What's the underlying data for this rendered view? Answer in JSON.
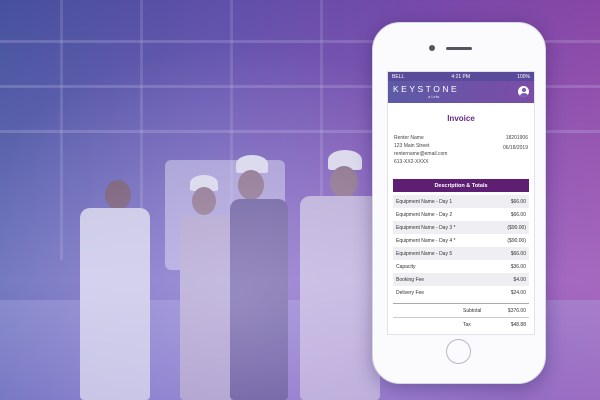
{
  "phone": {
    "status": {
      "carrier": "BELL",
      "time": "4:21 PM",
      "battery": "100%"
    },
    "brand": {
      "name": "KEYSTONE",
      "sub": "a Leta"
    },
    "invoice": {
      "title": "Invoice",
      "renter_name": "Renter Name",
      "address": "123 Main Street",
      "email": "rentername@email.com",
      "phone": "613-XX2-XXXX",
      "invoice_number": "18201906",
      "date": "06/18/2019",
      "section_title": "Description & Totals",
      "line_items": [
        {
          "label": "Equipment Name - Day 1",
          "amount": "$66.00"
        },
        {
          "label": "Equipment Name - Day 2",
          "amount": "$66.00"
        },
        {
          "label": "Equipment Name - Day 3 *",
          "amount": "($90.00)"
        },
        {
          "label": "Equipment Name - Day 4 *",
          "amount": "($90.00)"
        },
        {
          "label": "Equipment Name - Day 5",
          "amount": "$66.00"
        },
        {
          "label": "Capacity",
          "amount": "$36.00"
        },
        {
          "label": "Booking Fee",
          "amount": "$4.00"
        },
        {
          "label": "Delivery Fee",
          "amount": "$24.00"
        }
      ],
      "subtotal_label": "Subtotal",
      "subtotal": "$376.00",
      "tax_label": "Tax",
      "tax": "$48.88"
    }
  },
  "colors": {
    "accent": "#5e1f73",
    "title": "#6a2a86",
    "overlay_left": "#4a5aa8",
    "overlay_right": "#a04cb0"
  }
}
